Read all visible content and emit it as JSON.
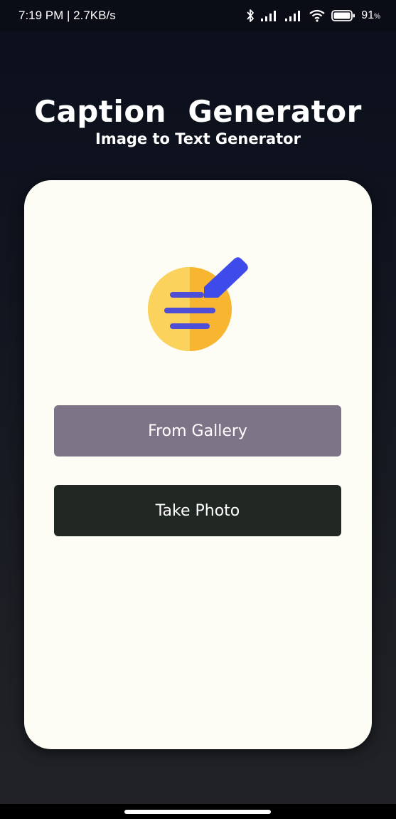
{
  "status_bar": {
    "time_speed": "7:19 PM | 2.7KB/s",
    "battery_percent": "91",
    "battery_unit": "%",
    "icons": [
      "bluetooth-icon",
      "signal-icon",
      "signal-icon",
      "wifi-icon",
      "battery-icon"
    ]
  },
  "header": {
    "title": "Caption  Generator",
    "subtitle": "Image to Text Generator"
  },
  "card": {
    "logo_icon": "caption-note-pencil-icon",
    "gallery_button": "From Gallery",
    "photo_button": "Take Photo"
  },
  "colors": {
    "card_bg": "#fdfdf6",
    "gallery_button": "#7e7487",
    "photo_button": "#212823",
    "logo_yellow": "#fbd35c",
    "logo_orange": "#f7b530",
    "logo_blue": "#3e4bea"
  }
}
